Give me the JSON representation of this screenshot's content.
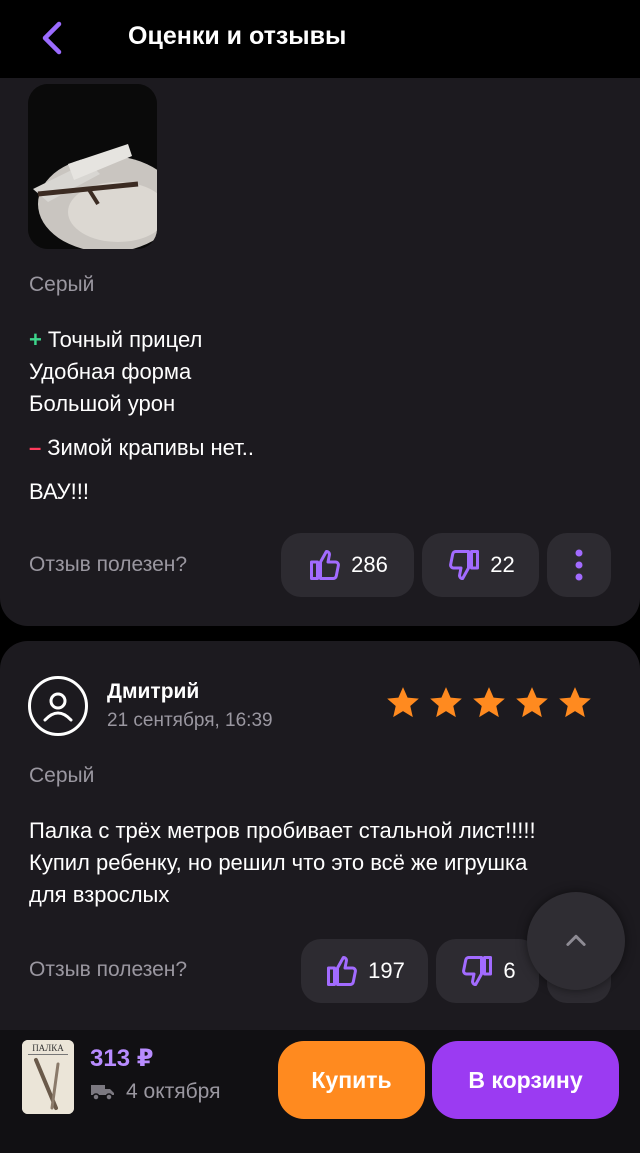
{
  "header": {
    "title": "Оценки и отзывы",
    "back_icon": "chevron-left-icon",
    "accent": "#9b6bff"
  },
  "review1": {
    "photo_icon": "review-photo",
    "variant": "Серый",
    "pros": [
      "Точный прицел",
      "Удобная форма",
      "Большой урон"
    ],
    "plus_sign": "+",
    "cons": "Зимой крапивы нет..",
    "minus_sign": "–",
    "comment": "ВАУ!!!",
    "helpful_label": "Отзыв полезен?",
    "likes": "286",
    "dislikes": "22",
    "more_icon": "more-vertical-icon"
  },
  "review2": {
    "author": "Дмитрий",
    "date": "21 сентября, 16:39",
    "rating": 5,
    "variant": "Серый",
    "text": [
      "Палка с трёх метров пробивает стальной лист!!!!!",
      "Купил ребенку, но решил что это всё же игрушка",
      "для взрослых"
    ],
    "helpful_label": "Отзыв полезен?",
    "likes": "197",
    "dislikes": "6"
  },
  "scroll_top_icon": "chevron-up-icon",
  "bottom_bar": {
    "price": "313 ₽",
    "delivery_date": "4 октября",
    "thumb_label": "ПАЛКА",
    "buy_label": "Купить",
    "cart_label": "В корзину",
    "buy_color": "#ff8a1f",
    "cart_color": "#9b3bf2"
  },
  "colors": {
    "star": "#ff8a1f",
    "price": "#b88cff",
    "plus": "#3dd68c",
    "minus": "#ff3b5c"
  }
}
